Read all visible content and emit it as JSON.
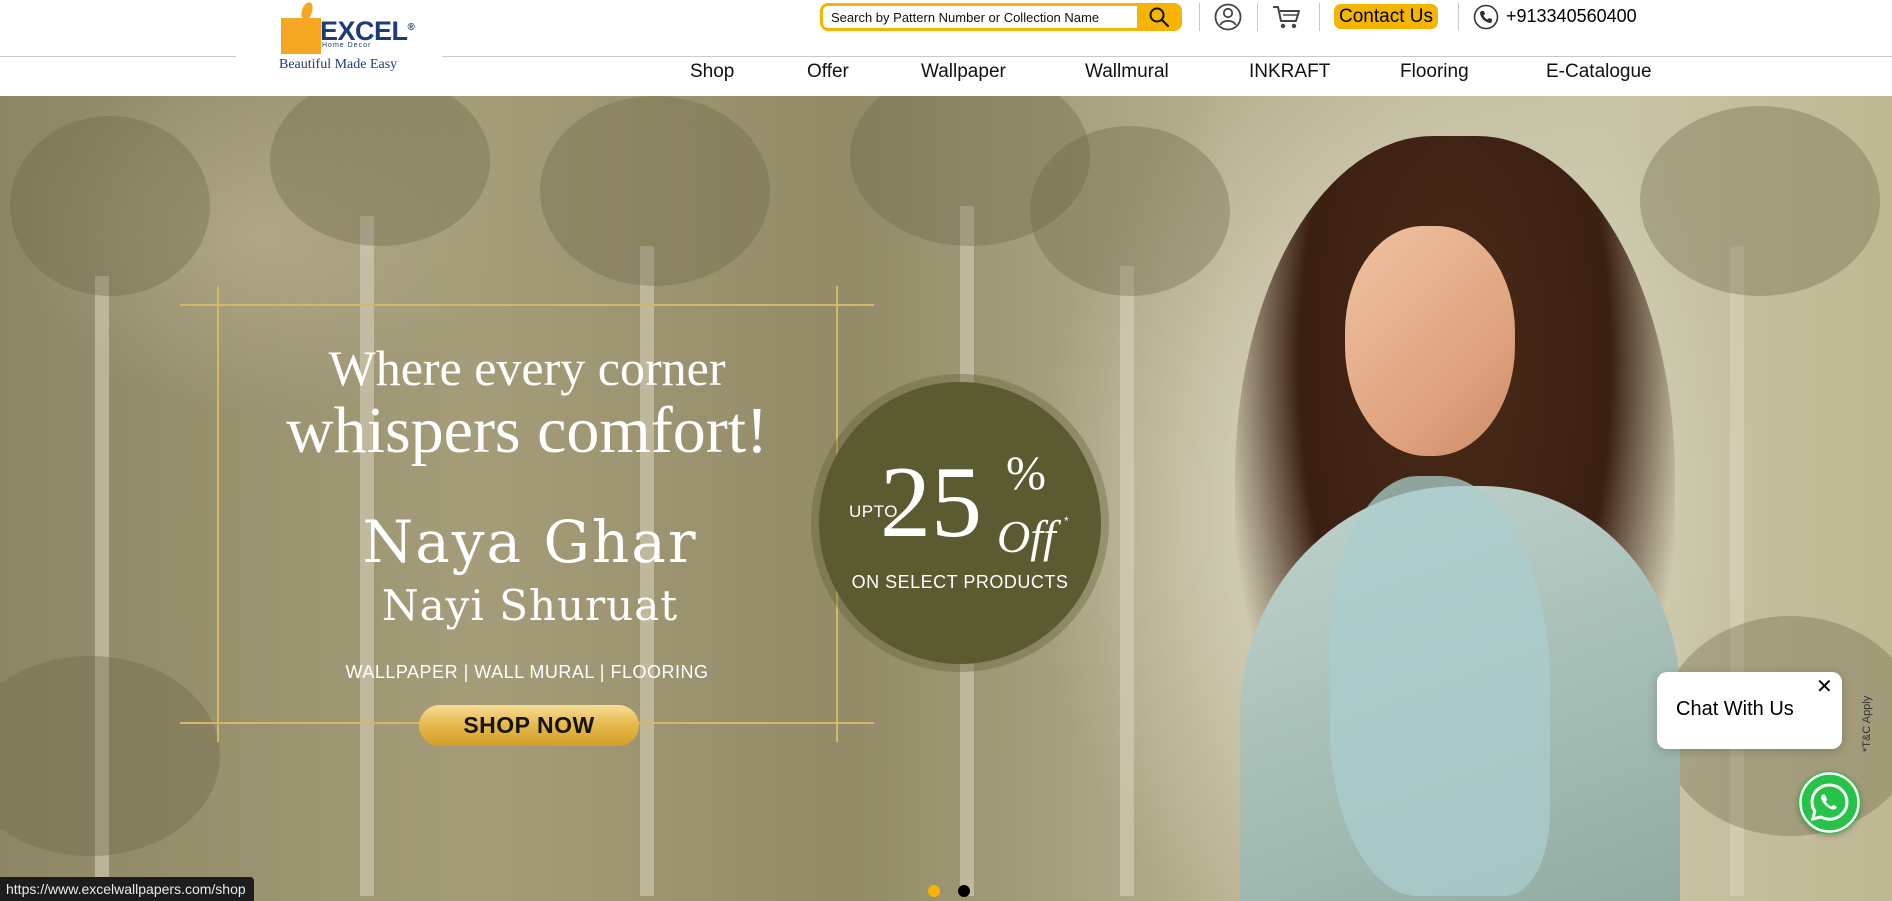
{
  "brand": {
    "logo_text": "EXCEL",
    "logo_registered": "®",
    "logo_sub": "Home Decor",
    "tagline": "Beautiful Made Easy"
  },
  "search": {
    "placeholder": "Search by Pattern Number or Collection Name",
    "icon": "search-icon"
  },
  "header": {
    "user_icon": "user-icon",
    "cart_icon": "cart-icon",
    "contact_label": "Contact Us",
    "phone_icon": "phone-icon",
    "phone": "+913340560400"
  },
  "nav": {
    "items": [
      {
        "label": "Shop"
      },
      {
        "label": "Offer"
      },
      {
        "label": "Wallpaper"
      },
      {
        "label": "Wallmural"
      },
      {
        "label": "INKRAFT"
      },
      {
        "label": "Flooring"
      },
      {
        "label": "E-Catalogue"
      }
    ]
  },
  "hero": {
    "headline_line1": "Where every corner",
    "headline_line2": "whispers comfort!",
    "script_line1": "Naya Ghar",
    "script_line2": "Nayi Shuruat",
    "categories": "WALLPAPER | WALL MURAL | FLOORING",
    "cta": "SHOP NOW",
    "offer_prefix": "UPTO",
    "offer_value": "25",
    "offer_percent": "%",
    "offer_suffix": "Off",
    "offer_asterisk": "*",
    "offer_note": "ON SELECT PRODUCTS",
    "disclaimer": "*T&C Apply",
    "slides": 2,
    "active_slide": 1
  },
  "chat": {
    "label": "Chat With Us",
    "close_glyph": "✕",
    "whatsapp_icon": "whatsapp-icon"
  },
  "status_bar": {
    "url": "https://www.excelwallpapers.com/shop"
  },
  "colors": {
    "accent": "#f5b400",
    "brand_blue": "#1f3c7a",
    "offer_circle": "#5c5a31",
    "whatsapp": "#27c24a",
    "dot_active": "#f5b400",
    "dot_inactive": "#000000"
  }
}
